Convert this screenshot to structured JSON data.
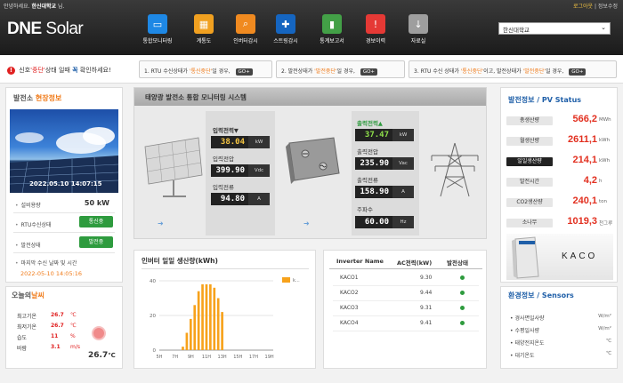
{
  "topbar": {
    "welcome_prefix": "안녕하세요.",
    "user": "한신대학교",
    "welcome_suffix": "님.",
    "logout": "로그아웃",
    "info": "정보수정"
  },
  "logo": {
    "brand": "DNE",
    "product": " Solar"
  },
  "nav": [
    {
      "label": "통합모니터링",
      "icon": "monitor-icon",
      "color": "#1e88e5",
      "glyph": "▭"
    },
    {
      "label": "계통도",
      "icon": "diagram-icon",
      "color": "#f0a020",
      "glyph": "▦"
    },
    {
      "label": "인버터감시",
      "icon": "magnifier-icon",
      "color": "#f08a20",
      "glyph": "⌕"
    },
    {
      "label": "스트링감시",
      "icon": "string-icon",
      "color": "#1565c0",
      "glyph": "✚"
    },
    {
      "label": "통계보고서",
      "icon": "bar-chart-icon",
      "color": "#43a047",
      "glyph": "▮"
    },
    {
      "label": "경보이력",
      "icon": "warning-icon",
      "color": "#e53935",
      "glyph": "!"
    },
    {
      "label": "자료실",
      "icon": "download-icon",
      "color": "#9e9e9e",
      "glyph": "↓"
    }
  ],
  "site_select": {
    "value": "한신대학교"
  },
  "notice": {
    "alert_pre": "신호",
    "alert_red": "'중단'",
    "alert_mid": "상태 일때",
    "alert_blue": "꼭",
    "alert_post": "확인하세요!",
    "guides": [
      {
        "pre": "1. RTU 수신상태가",
        "hl": "'통신중단'",
        "post": "일 경우,",
        "go": "GO+"
      },
      {
        "pre": "2. 발전상태가",
        "hl": "'발전중단'",
        "post": "일 경우,",
        "go": "GO+"
      },
      {
        "pre": "3. RTU 수신 상태가",
        "hl": "'통신중단'",
        "mid": "이고, 발전상태가",
        "hl2": "'발전중단'",
        "post": "일 경우,",
        "go": "GO+"
      }
    ]
  },
  "plant_info": {
    "title_pre": "발전소 ",
    "title_hl": "현장정보",
    "timestamp": "2022.05.10 14:07:15",
    "capacity_label": "설비용량",
    "capacity_value": "50",
    "capacity_unit": "kW",
    "rtu_label": "RTU수신상태",
    "rtu_status": "통신중",
    "gen_label": "발전상태",
    "gen_status": "발전중",
    "last_label": "마지막 수신 날짜 및 시간",
    "last_value": "2022-05-10 14:05:16"
  },
  "weather": {
    "title_pre": "오늘의",
    "title_hl": "날씨",
    "rows": [
      {
        "label": "최고기온",
        "value": "26.7",
        "unit": "℃"
      },
      {
        "label": "최저기온",
        "value": "26.7",
        "unit": "℃"
      },
      {
        "label": "습도",
        "value": "11",
        "unit": "%"
      },
      {
        "label": "바람",
        "value": "3.1",
        "unit": "m/s"
      }
    ],
    "current_temp": "26.7",
    "current_unit": "℃"
  },
  "monitor": {
    "title": "태양광 발전소 통합 모니터링 시스템",
    "input_power_label": "입력전력▼",
    "input_power": "38.04",
    "input_power_unit": "kW",
    "input_voltage_label": "입력전압",
    "input_voltage": "399.90",
    "input_voltage_unit": "Vdc",
    "input_current_label": "입력전류",
    "input_current": "94.80",
    "input_current_unit": "A",
    "output_power_label": "출력전력▲",
    "output_power": "37.47",
    "output_power_unit": "kW",
    "output_voltage_label": "출력전압",
    "output_voltage": "235.90",
    "output_voltage_unit": "Vac",
    "output_current_label": "출력전류",
    "output_current": "158.90",
    "output_current_unit": "A",
    "frequency_label": "주파수",
    "frequency": "60.00",
    "frequency_unit": "Hz"
  },
  "chart_panel": {
    "title": "인버터 일일 생산량(kWh)"
  },
  "chart_data": {
    "type": "bar",
    "categories": [
      "5H",
      "6H",
      "7H",
      "8H",
      "9H",
      "10H",
      "11H",
      "12H",
      "13H",
      "14H",
      "15H",
      "16H",
      "17H",
      "18H",
      "19H"
    ],
    "tick_labels": [
      "5H",
      "7H",
      "9H",
      "11H",
      "13H",
      "15H",
      "17H",
      "19H"
    ],
    "series": [
      {
        "name": "k...",
        "values": [
          0,
          0,
          0,
          2,
          10,
          18,
          26,
          34,
          38,
          38,
          38,
          36,
          30,
          22,
          0,
          0,
          0,
          0,
          0,
          0,
          0,
          0,
          0,
          0,
          0,
          0,
          0,
          0,
          0
        ]
      }
    ],
    "bar_values": [
      2,
      10,
      18,
      26,
      34,
      38,
      38,
      38,
      36,
      30,
      22
    ],
    "bar_hours": [
      8,
      8.5,
      9,
      9.5,
      10,
      10.5,
      11,
      11.5,
      12,
      12.5,
      13
    ],
    "ylim": [
      0,
      40
    ],
    "yticks": [
      0,
      20,
      40
    ],
    "color": "#f7a21b"
  },
  "inverter_table": {
    "headers": [
      "Inverter Name",
      "AC전력(kW)",
      "발전상태"
    ],
    "rows": [
      {
        "name": "KACO1",
        "ac": "9.30"
      },
      {
        "name": "KACO2",
        "ac": "9.44"
      },
      {
        "name": "KACO3",
        "ac": "9.31"
      },
      {
        "name": "KACO4",
        "ac": "9.41"
      }
    ]
  },
  "pv_status": {
    "title": "발전정보 / PV Status",
    "rows": [
      {
        "label": "총생산량",
        "value": "566,2",
        "unit": "MWh"
      },
      {
        "label": "월생산량",
        "value": "2611,1",
        "unit": "kWh"
      },
      {
        "label": "일일생산량",
        "value": "214,1",
        "unit": "kWh"
      },
      {
        "label": "발전시간",
        "value": "4,2",
        "unit": "h"
      },
      {
        "label": "CO2생산량",
        "value": "240,1",
        "unit": "ton"
      },
      {
        "label": "소나무",
        "value": "1019,3",
        "unit": "천그루"
      }
    ],
    "brand": "KACO"
  },
  "sensors": {
    "title": "환경정보 / Sensors",
    "rows": [
      {
        "label": "경사면일사량",
        "unit": "W/m²"
      },
      {
        "label": "수평일사량",
        "unit": "W/m²"
      },
      {
        "label": "태양전지온도",
        "unit": "℃"
      },
      {
        "label": "대기온도",
        "unit": "℃"
      }
    ]
  },
  "colors": {
    "accent": "#f07b1a",
    "alert": "#e02020",
    "ok": "#2e9b3e",
    "header": "#2a2a2a"
  }
}
